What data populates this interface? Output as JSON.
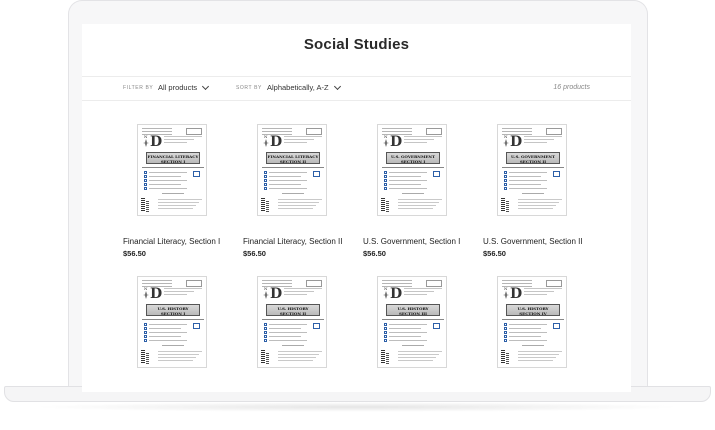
{
  "page": {
    "title": "Social Studies"
  },
  "toolbar": {
    "filter_label": "Filter by",
    "filter_value": "All products",
    "sort_label": "Sort by",
    "sort_value": "Alphabetically, A-Z",
    "count_text": "16 products"
  },
  "products": [
    {
      "title": "Financial Literacy, Section I",
      "price": "$56.50",
      "banner_1": "FINANCIAL LITERACY",
      "banner_2": "SECTION I"
    },
    {
      "title": "Financial Literacy, Section II",
      "price": "$56.50",
      "banner_1": "FINANCIAL LITERACY",
      "banner_2": "SECTION II"
    },
    {
      "title": "U.S. Government, Section I",
      "price": "$56.50",
      "banner_1": "U.S. GOVERNMENT",
      "banner_2": "SECTION I"
    },
    {
      "title": "U.S. Government, Section II",
      "price": "$56.50",
      "banner_1": "U.S. GOVERNMENT",
      "banner_2": "SECTION II"
    },
    {
      "banner_1": "U.S. HISTORY",
      "banner_2": "SECTION I"
    },
    {
      "banner_1": "U.S. HISTORY",
      "banner_2": "SECTION II"
    },
    {
      "banner_1": "U.S. HISTORY",
      "banner_2": "SECTION III"
    },
    {
      "banner_1": "U.S. HISTORY",
      "banner_2": "SECTION IV"
    }
  ],
  "colors": {
    "checkbox_accent": "#2c5fa8",
    "text": "#222222"
  }
}
